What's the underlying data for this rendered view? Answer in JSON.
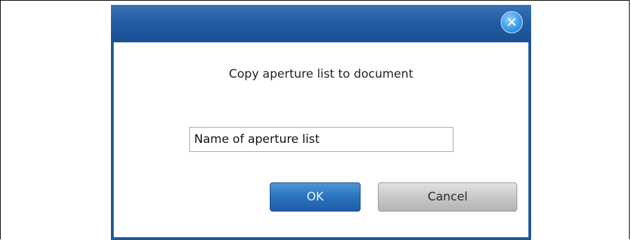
{
  "dialog": {
    "message": "Copy aperture list to document",
    "input": {
      "value": "Name of aperture list",
      "placeholder": ""
    },
    "ok_label": "OK",
    "cancel_label": "Cancel",
    "close_glyph": "✕",
    "colors": {
      "titlebar": "#235da5",
      "border": "#1e5799",
      "ok_button": "#2a73bd",
      "cancel_button": "#c9c9c9"
    },
    "icons": {
      "close": "close-icon",
      "resize": "resize-grip-icon"
    }
  }
}
